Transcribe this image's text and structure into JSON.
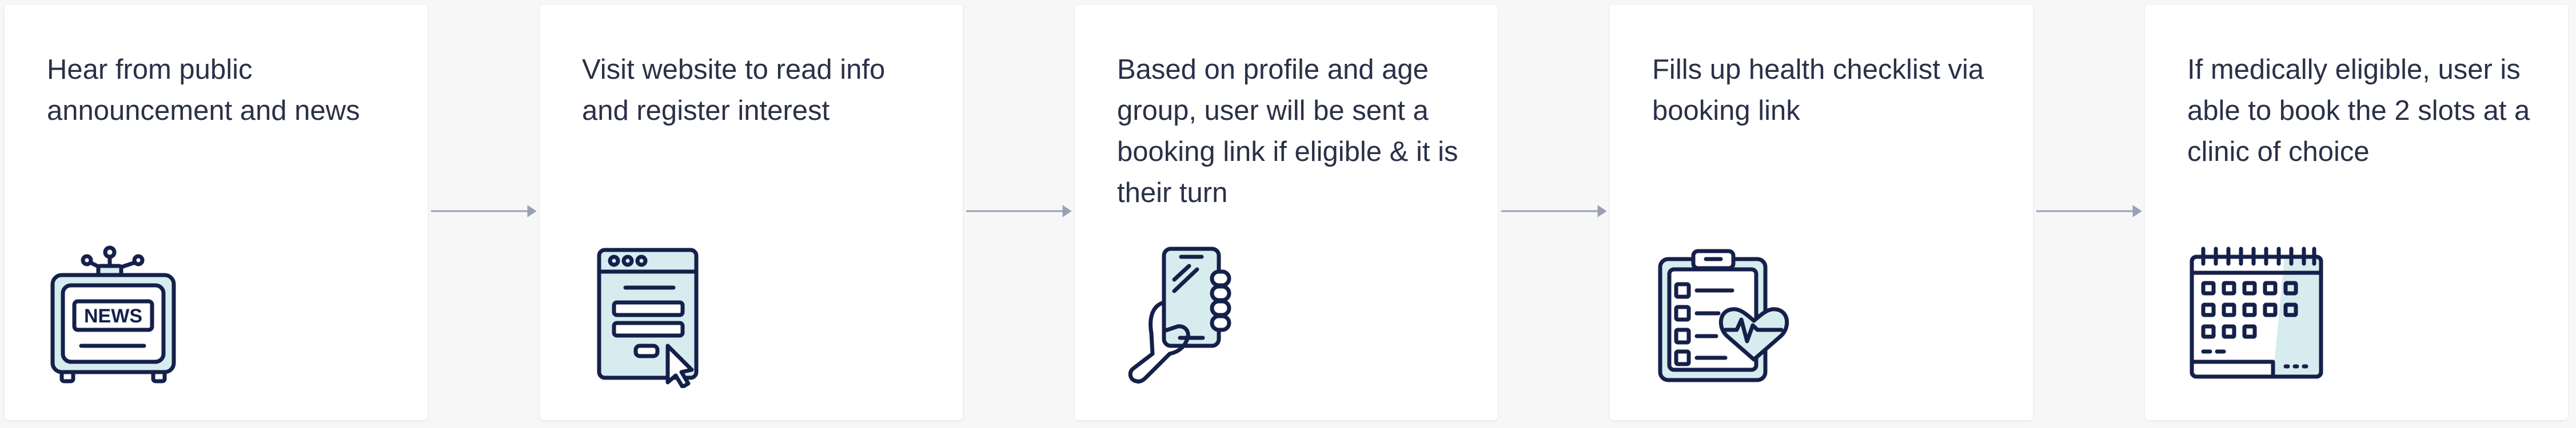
{
  "colors": {
    "ink": "#15204a",
    "fill": "#d6ecef",
    "arrow": "#9aa0b4",
    "text": "#2a3047"
  },
  "steps": [
    {
      "text": "Hear from public announcement and news",
      "icon": "news-tv-icon",
      "icon_text": "NEWS"
    },
    {
      "text": "Visit website to read info and register interest",
      "icon": "browser-form-icon"
    },
    {
      "text": "Based on profile and age group, user will be sent a booking link if eligible & it is their turn",
      "icon": "phone-in-hand-icon"
    },
    {
      "text": "Fills up health checklist via booking link",
      "icon": "health-checklist-icon"
    },
    {
      "text": "If medically eligible, user is able to book the 2 slots at a clinic of choice",
      "icon": "calendar-icon"
    }
  ]
}
